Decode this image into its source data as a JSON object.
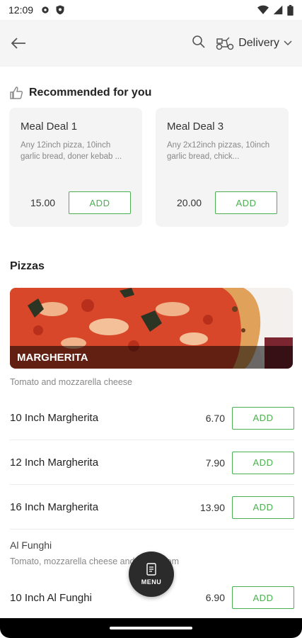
{
  "status": {
    "time": "12:09"
  },
  "header": {
    "delivery_label": "Delivery"
  },
  "recommended": {
    "title": "Recommended for you",
    "items": [
      {
        "name": "Meal Deal 1",
        "desc": "Any 12inch pizza, 10inch garlic bread, doner kebab ...",
        "price": "15.00",
        "add": "ADD"
      },
      {
        "name": "Meal Deal 3",
        "desc": "Any 2x12inch pizzas, 10inch garlic bread, chick...",
        "price": "20.00",
        "add": "ADD"
      }
    ]
  },
  "pizzas": {
    "title": "Pizzas",
    "banner_label": "MARGHERITA",
    "desc": "Tomato and mozzarella cheese",
    "items": [
      {
        "name": "10 Inch Margherita",
        "price": "6.70",
        "add": "ADD"
      },
      {
        "name": "12 Inch Margherita",
        "price": "7.90",
        "add": "ADD"
      },
      {
        "name": "16 Inch Margherita",
        "price": "13.90",
        "add": "ADD"
      }
    ]
  },
  "funghi": {
    "title": "Al Funghi",
    "desc": "Tomato, mozzarella cheese and mushroom",
    "items": [
      {
        "name": "10 Inch Al Funghi",
        "price": "6.90",
        "add": "ADD"
      }
    ]
  },
  "fab": {
    "label": "MENU"
  }
}
